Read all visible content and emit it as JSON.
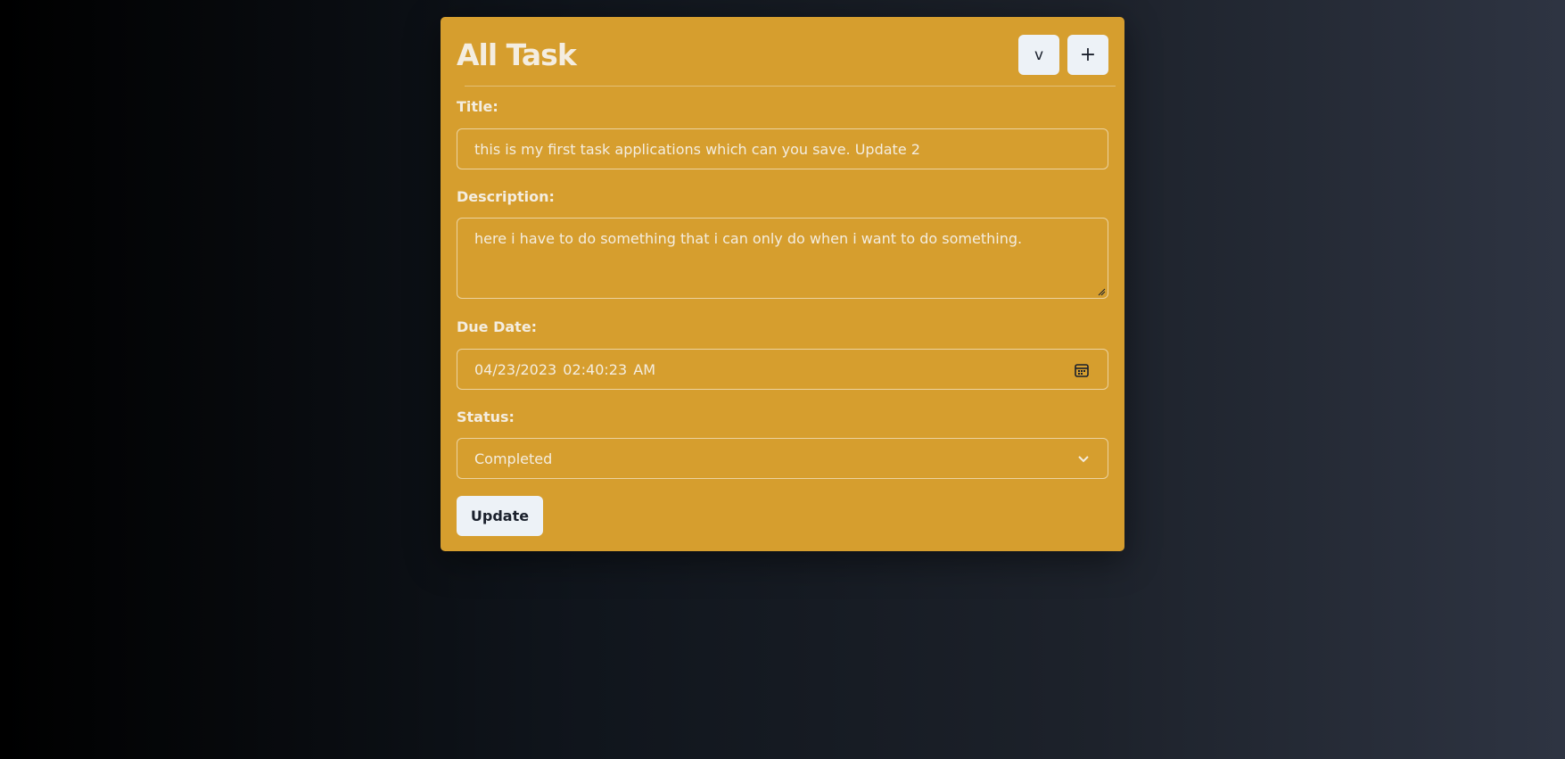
{
  "colors": {
    "card_background": "#d69e2e",
    "button_background": "#edf2f7",
    "text_light": "#f4ede0",
    "text_dark": "#1a202c"
  },
  "header": {
    "title": "All Task",
    "collapse_label": "v",
    "add_label": "+"
  },
  "form": {
    "title_label": "Title:",
    "title_value": "this is my first task applications which can you save. Update 2",
    "description_label": "Description:",
    "description_value": "here i have to do something that i can only do when i want to do something.",
    "due_date_label": "Due Date:",
    "due_date_value": "04/23/2023 02:40:23 AM",
    "status_label": "Status:",
    "status_value": "Completed",
    "submit_label": "Update"
  },
  "icons": {
    "date_picker": "calendar-icon",
    "select_arrow": "chevron-down-icon",
    "textarea_resize": "resize-handle-icon"
  }
}
